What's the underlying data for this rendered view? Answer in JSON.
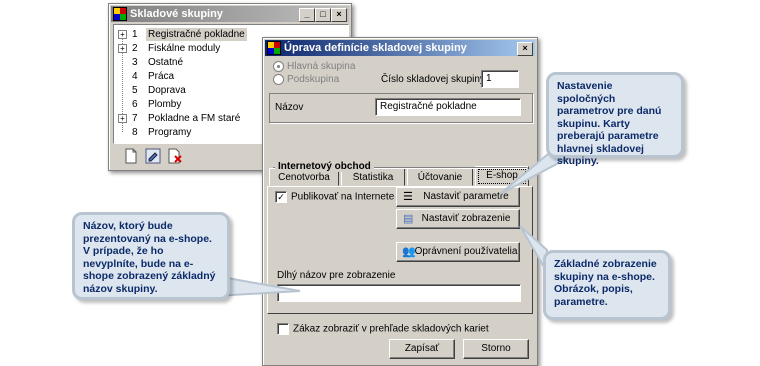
{
  "back_window": {
    "title": "Skladové skupiny",
    "tree": [
      {
        "num": "1",
        "label": "Registračné pokladne",
        "expand": "+",
        "selected": true
      },
      {
        "num": "2",
        "label": "Fiskálne moduly",
        "expand": "+"
      },
      {
        "num": "3",
        "label": "Ostatné"
      },
      {
        "num": "4",
        "label": "Práca"
      },
      {
        "num": "5",
        "label": "Doprava"
      },
      {
        "num": "6",
        "label": "Plomby"
      },
      {
        "num": "7",
        "label": "Pokladne a FM staré",
        "expand": "+"
      },
      {
        "num": "8",
        "label": "Programy"
      }
    ],
    "bottom_icons": [
      "new-document-icon",
      "edit-document-icon",
      "delete-document-icon"
    ]
  },
  "dialog": {
    "title": "Úprava definície skladovej skupiny",
    "radio_main": "Hlavná skupina",
    "radio_sub": "Podskupina",
    "group_number_label": "Číslo skladovej skupiny",
    "group_number_value": "1",
    "name_label": "Názov",
    "name_value": "Registračné pokladne",
    "tabs": [
      "Cenotvorba",
      "Štatistika",
      "Účtovanie",
      "E-shop"
    ],
    "section_title": "Internetový obchod",
    "publish_label": "Publikovať na Internete",
    "btn_params": "Nastaviť parametre",
    "btn_display": "Nastaviť zobrazenie",
    "btn_permissions": "Oprávnení používatelia",
    "long_name_label": "Dlhý názov pre zobrazenie",
    "long_name_value": "",
    "hide_label": "Zákaz zobraziť v prehľade skladových kariet",
    "btn_save": "Zapísať",
    "btn_cancel": "Storno"
  },
  "callouts": {
    "params": "Nastavenie spoločných parametrov pre danú skupinu. Karty preberajú parametre hlavnej skladovej skupiny.",
    "name": "Názov, ktorý bude prezentovaný na e-shope. V prípade, že ho nevyplníte, bude na e-shope zobrazený základný názov skupiny.",
    "display": "Základné zobrazenie skupiny na e-shope. Obrázok, popis, parametre."
  },
  "colors": {
    "callout_text": "#0c2a6a",
    "callout_bg": "#dde6ee",
    "active_title": "#0a246a"
  }
}
